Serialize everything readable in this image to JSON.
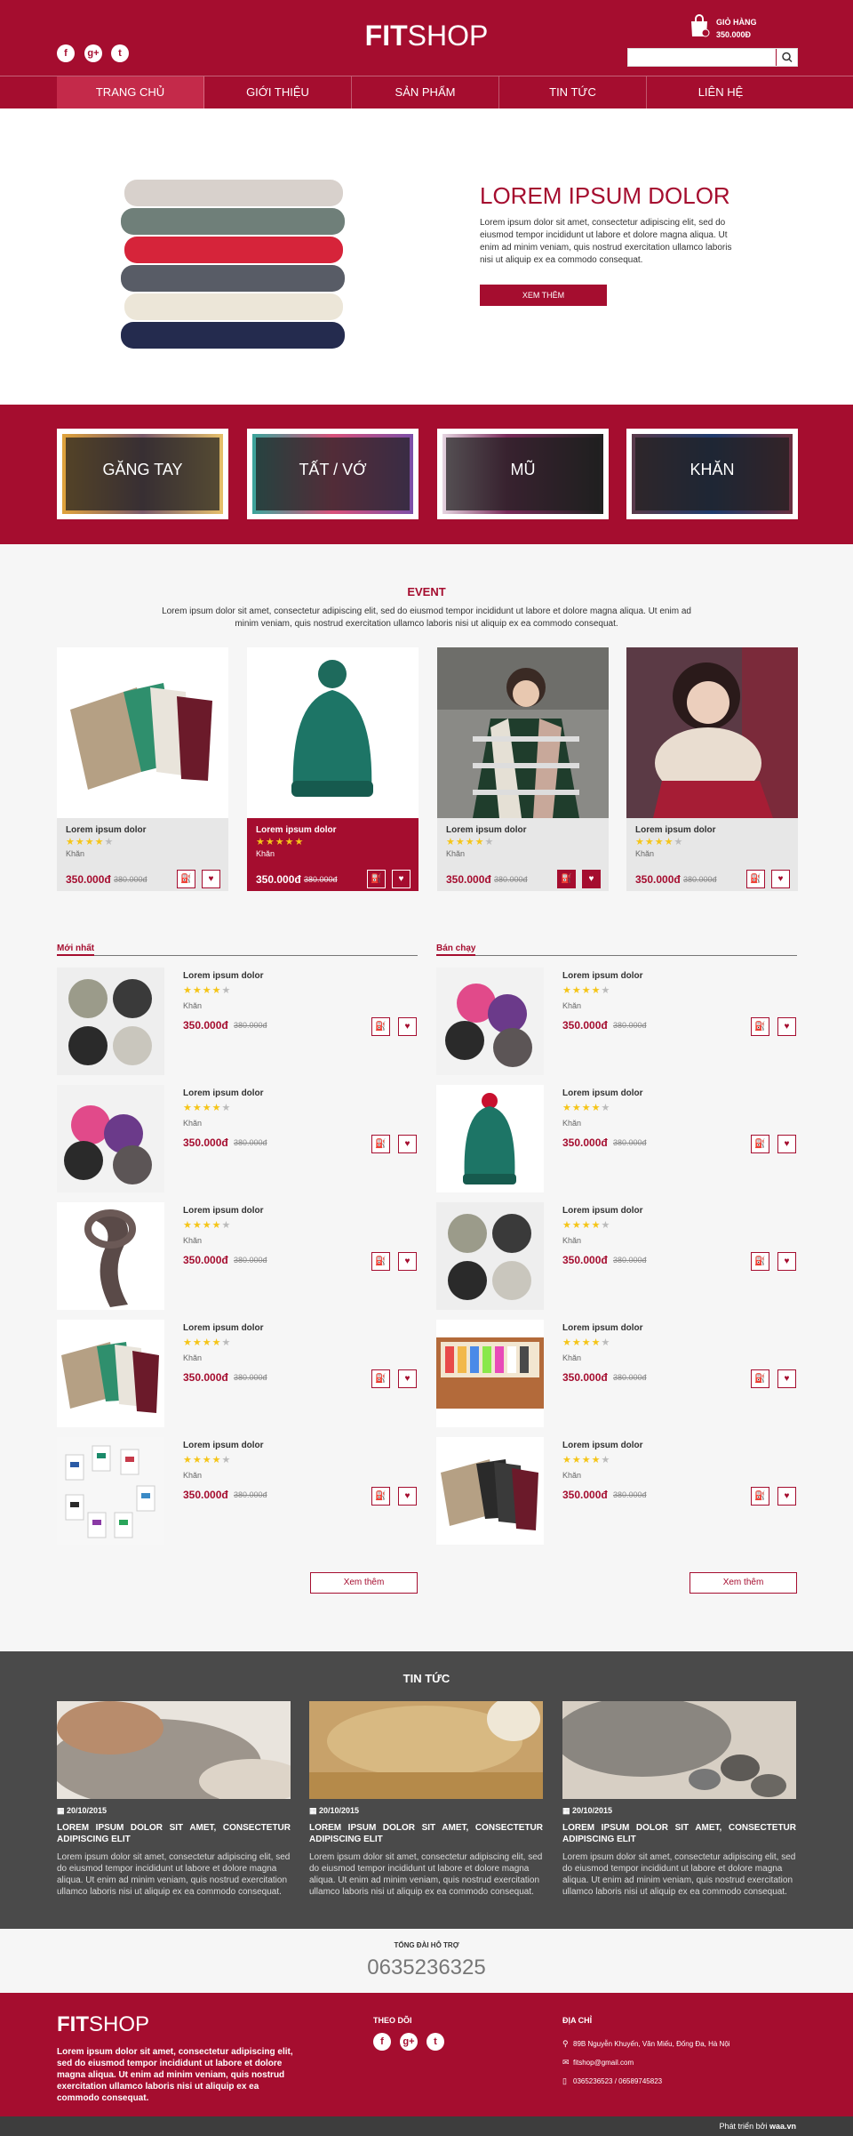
{
  "colors": {
    "brand": "#a50d2f",
    "dark": "#4a4a4a",
    "light": "#f6f6f6"
  },
  "header": {
    "logo_bold": "FIT",
    "logo_rest": "SHOP",
    "social": [
      "f",
      "g+",
      "t"
    ],
    "cart_label": "GIỎ HÀNG",
    "cart_total": "350.000Đ",
    "search": {
      "value": "",
      "placeholder": ""
    },
    "nav": [
      "TRANG CHỦ",
      "GIỚI THIỆU",
      "SẢN PHẨM",
      "TIN TỨC",
      "LIÊN HỆ"
    ]
  },
  "hero": {
    "title": "LOREM IPSUM DOLOR",
    "text": "Lorem ipsum dolor sit amet, consectetur adipiscing elit, sed do eiusmod tempor incididunt ut labore et dolore magna aliqua. Ut enim ad minim veniam, quis nostrud exercitation ullamco laboris nisi ut aliquip ex ea commodo consequat.",
    "button": "XEM THÊM"
  },
  "categories": [
    "GĂNG TAY",
    "TẤT / VỚ",
    "MŨ",
    "KHĂN"
  ],
  "event": {
    "title": "EVENT",
    "text": "Lorem ipsum dolor sit amet, consectetur adipiscing elit, sed do eiusmod tempor incididunt ut labore et dolore magna aliqua. Ut enim ad minim veniam, quis nostrud exercitation ullamco laboris nisi ut aliquip ex ea commodo consequat.",
    "products": [
      {
        "name": "Lorem ipsum dolor",
        "stars": 4,
        "category": "Khăn",
        "price": "350.000đ",
        "old_price": "380.000đ"
      },
      {
        "name": "Lorem ipsum dolor",
        "stars": 5,
        "category": "Khăn",
        "price": "350.000đ",
        "old_price": "380.000đ"
      },
      {
        "name": "Lorem ipsum dolor",
        "stars": 4,
        "category": "Khăn",
        "price": "350.000đ",
        "old_price": "380.000đ"
      },
      {
        "name": "Lorem ipsum dolor",
        "stars": 4,
        "category": "Khăn",
        "price": "350.000đ",
        "old_price": "380.000đ"
      }
    ]
  },
  "newest": {
    "title": "Mới nhất",
    "more": "Xem thêm",
    "items": [
      {
        "name": "Lorem ipsum dolor",
        "stars": 4,
        "category": "Khăn",
        "price": "350.000đ",
        "old_price": "380.000đ"
      },
      {
        "name": "Lorem ipsum dolor",
        "stars": 4,
        "category": "Khăn",
        "price": "350.000đ",
        "old_price": "380.000đ"
      },
      {
        "name": "Lorem ipsum dolor",
        "stars": 4,
        "category": "Khăn",
        "price": "350.000đ",
        "old_price": "380.000đ"
      },
      {
        "name": "Lorem ipsum dolor",
        "stars": 4,
        "category": "Khăn",
        "price": "350.000đ",
        "old_price": "380.000đ"
      },
      {
        "name": "Lorem ipsum dolor",
        "stars": 4,
        "category": "Khăn",
        "price": "350.000đ",
        "old_price": "380.000đ"
      }
    ]
  },
  "bestseller": {
    "title": "Bán chạy",
    "more": "Xem thêm",
    "items": [
      {
        "name": "Lorem ipsum dolor",
        "stars": 4,
        "category": "Khăn",
        "price": "350.000đ",
        "old_price": "380.000đ"
      },
      {
        "name": "Lorem ipsum dolor",
        "stars": 4,
        "category": "Khăn",
        "price": "350.000đ",
        "old_price": "380.000đ"
      },
      {
        "name": "Lorem ipsum dolor",
        "stars": 4,
        "category": "Khăn",
        "price": "350.000đ",
        "old_price": "380.000đ"
      },
      {
        "name": "Lorem ipsum dolor",
        "stars": 4,
        "category": "Khăn",
        "price": "350.000đ",
        "old_price": "380.000đ"
      },
      {
        "name": "Lorem ipsum dolor",
        "stars": 4,
        "category": "Khăn",
        "price": "350.000đ",
        "old_price": "380.000đ"
      }
    ]
  },
  "news": {
    "title": "TIN TỨC",
    "items": [
      {
        "date": "20/10/2015",
        "title": "LOREM IPSUM DOLOR SIT AMET, CONSECTETUR ADIPISCING ELIT",
        "text": "Lorem ipsum dolor sit amet, consectetur adipiscing elit, sed do eiusmod tempor incididunt ut labore et dolore magna aliqua. Ut enim ad minim veniam, quis nostrud exercitation ullamco laboris nisi ut aliquip ex ea commodo consequat."
      },
      {
        "date": "20/10/2015",
        "title": "LOREM IPSUM DOLOR SIT AMET, CONSECTETUR ADIPISCING ELIT",
        "text": "Lorem ipsum dolor sit amet, consectetur adipiscing elit, sed do eiusmod tempor incididunt ut labore et dolore magna aliqua. Ut enim ad minim veniam, quis nostrud exercitation ullamco laboris nisi ut aliquip ex ea commodo consequat."
      },
      {
        "date": "20/10/2015",
        "title": "LOREM IPSUM DOLOR SIT AMET, CONSECTETUR ADIPISCING ELIT",
        "text": "Lorem ipsum dolor sit amet, consectetur adipiscing elit, sed do eiusmod tempor incididunt ut labore et dolore magna aliqua. Ut enim ad minim veniam, quis nostrud exercitation ullamco laboris nisi ut aliquip ex ea commodo consequat."
      }
    ]
  },
  "hotline": {
    "label": "TỔNG ĐÀI HỖ TRỢ",
    "number": "0635236325"
  },
  "footer": {
    "logo_bold": "FIT",
    "logo_rest": "SHOP",
    "text": "Lorem ipsum dolor sit amet, consectetur adipiscing elit, sed do eiusmod tempor incididunt ut labore et dolore magna aliqua. Ut enim ad minim veniam, quis nostrud exercitation ullamco laboris nisi ut aliquip ex ea commodo consequat.",
    "follow": "THEO DÕI",
    "address_title": "ĐỊA CHỈ",
    "address": "89B Nguyễn Khuyến, Văn Miếu, Đống Đa, Hà Nội",
    "email": "fitshop@gmail.com",
    "phone": "0365236523 / 06589745823",
    "credit_prefix": "Phát triển bởi ",
    "credit_site": "waa.vn"
  }
}
